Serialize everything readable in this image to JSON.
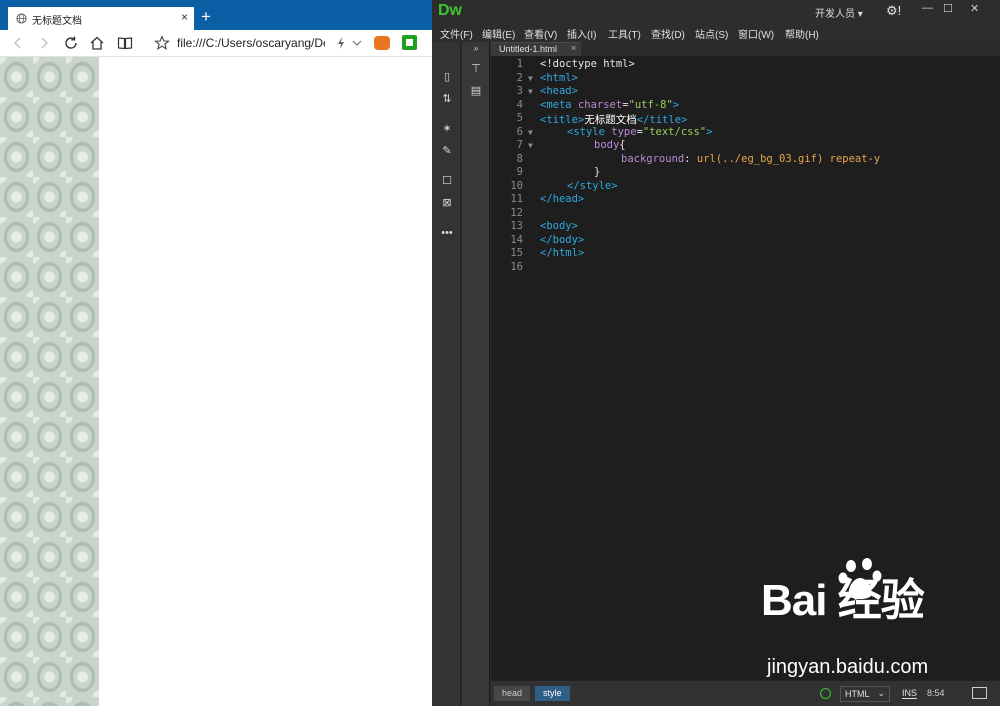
{
  "browser": {
    "tab_title": "无标题文档",
    "tab_close": "×",
    "new_tab": "+",
    "address": "file:///C:/Users/oscaryang/De"
  },
  "dw": {
    "logo": "Dw",
    "workspace": "开发人员",
    "window_controls": {
      "minimize": "—",
      "maximize": "☐",
      "close": "✕"
    },
    "menu": [
      "文件(F)",
      "编辑(E)",
      "查看(V)",
      "插入(I)",
      "工具(T)",
      "查找(D)",
      "站点(S)",
      "窗口(W)",
      "帮助(H)"
    ],
    "document_tab": "Untitled-1.html",
    "code_lines": [
      {
        "n": "1",
        "fold": "",
        "indent": 0,
        "tokens": [
          [
            "punct",
            "<!doctype html>"
          ]
        ]
      },
      {
        "n": "2",
        "fold": "▼",
        "indent": 0,
        "tokens": [
          [
            "tag",
            "<html>"
          ]
        ]
      },
      {
        "n": "3",
        "fold": "▼",
        "indent": 0,
        "tokens": [
          [
            "tag",
            "<head>"
          ]
        ]
      },
      {
        "n": "4",
        "fold": "",
        "indent": 0,
        "tokens": [
          [
            "tag",
            "<meta "
          ],
          [
            "attr",
            "charset"
          ],
          [
            "punct",
            "="
          ],
          [
            "str",
            "\"utf-8\""
          ],
          [
            "tag",
            ">"
          ]
        ]
      },
      {
        "n": "5",
        "fold": "",
        "indent": 0,
        "tokens": [
          [
            "tag",
            "<title>"
          ],
          [
            "text",
            "无标题文档"
          ],
          [
            "tag",
            "</title>"
          ]
        ]
      },
      {
        "n": "6",
        "fold": "▼",
        "indent": 1,
        "tokens": [
          [
            "tag",
            "<style "
          ],
          [
            "attr",
            "type"
          ],
          [
            "punct",
            "="
          ],
          [
            "str",
            "\"text/css\""
          ],
          [
            "tag",
            ">"
          ]
        ]
      },
      {
        "n": "7",
        "fold": "▼",
        "indent": 2,
        "tokens": [
          [
            "prop",
            "body"
          ],
          [
            "punct",
            "{"
          ]
        ]
      },
      {
        "n": "8",
        "fold": "",
        "indent": 3,
        "tokens": [
          [
            "prop",
            "background"
          ],
          [
            "punct",
            ": "
          ],
          [
            "val",
            "url(../eg_bg_03.gif) repeat-y"
          ]
        ]
      },
      {
        "n": "9",
        "fold": "",
        "indent": 2,
        "tokens": [
          [
            "punct",
            "}"
          ]
        ]
      },
      {
        "n": "10",
        "fold": "",
        "indent": 1,
        "tokens": [
          [
            "tag",
            "</style>"
          ]
        ]
      },
      {
        "n": "11",
        "fold": "",
        "indent": 0,
        "tokens": [
          [
            "tag",
            "</head>"
          ]
        ]
      },
      {
        "n": "12",
        "fold": "",
        "indent": 0,
        "tokens": []
      },
      {
        "n": "13",
        "fold": "",
        "indent": 0,
        "tokens": [
          [
            "tag",
            "<body>"
          ]
        ]
      },
      {
        "n": "14",
        "fold": "",
        "indent": 0,
        "tokens": [
          [
            "tag",
            "</body>"
          ]
        ]
      },
      {
        "n": "15",
        "fold": "",
        "indent": 0,
        "tokens": [
          [
            "tag",
            "</html>"
          ]
        ]
      },
      {
        "n": "16",
        "fold": "",
        "indent": 0,
        "tokens": []
      }
    ],
    "status": {
      "crumbs": [
        "head",
        "style"
      ],
      "language": "HTML",
      "mode": "INS",
      "position": "8:54"
    }
  },
  "watermark": {
    "brand": "Bai  经验",
    "site": "jingyan.baidu.com"
  },
  "colors": {
    "tag": "#2fa8e0",
    "attr": "#b98ad8",
    "string": "#9bcf5b",
    "value": "#e7a64a",
    "dw_green": "#3ec42f",
    "browser_tabbar": "#0b5fa5"
  }
}
